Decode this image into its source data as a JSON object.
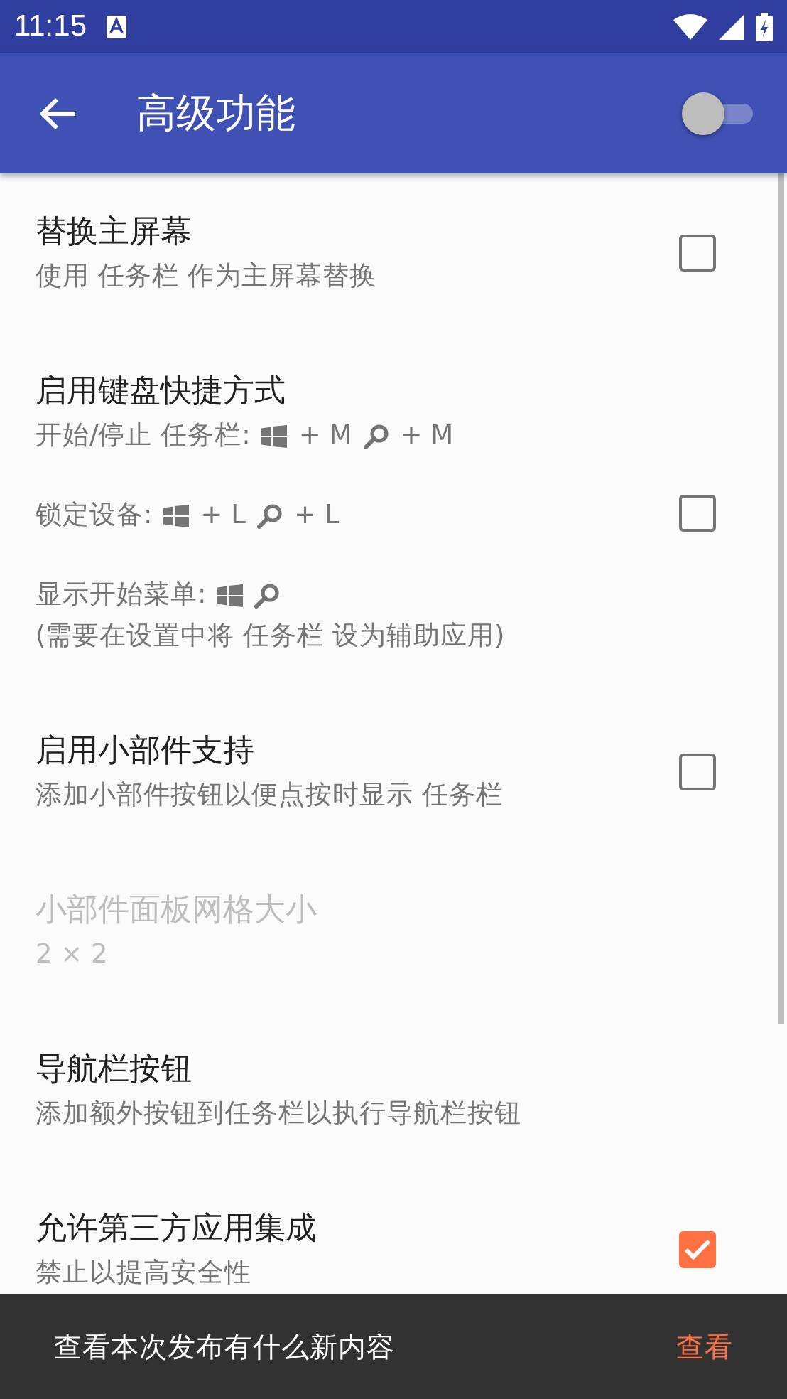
{
  "status_bar": {
    "time": "11:15"
  },
  "app_bar": {
    "title": "高级功能",
    "switch_on": false
  },
  "settings": [
    {
      "title": "替换主屏幕",
      "disabled": false,
      "checked": false,
      "groups": [
        [
          [
            {
              "kind": "text",
              "text": "使用 任务栏 作为主屏幕替换"
            }
          ]
        ]
      ]
    },
    {
      "title": "启用键盘快捷方式",
      "disabled": false,
      "checked": false,
      "groups": [
        [
          [
            {
              "kind": "text",
              "text": "开始/停止 任务栏:"
            },
            {
              "kind": "windows"
            },
            {
              "kind": "text",
              "text": "+ M"
            },
            {
              "kind": "search"
            },
            {
              "kind": "text",
              "text": "+ M"
            }
          ]
        ],
        [
          [
            {
              "kind": "text",
              "text": "锁定设备:"
            },
            {
              "kind": "windows"
            },
            {
              "kind": "text",
              "text": "+ L"
            },
            {
              "kind": "search"
            },
            {
              "kind": "text",
              "text": "+ L"
            }
          ]
        ],
        [
          [
            {
              "kind": "text",
              "text": "显示开始菜单:"
            },
            {
              "kind": "windows"
            },
            {
              "kind": "search"
            }
          ],
          [
            {
              "kind": "text",
              "text": "(需要在设置中将 任务栏 设为辅助应用)"
            }
          ]
        ]
      ]
    },
    {
      "title": "启用小部件支持",
      "disabled": false,
      "checked": false,
      "groups": [
        [
          [
            {
              "kind": "text",
              "text": "添加小部件按钮以便点按时显示 任务栏"
            }
          ]
        ]
      ]
    },
    {
      "title": "小部件面板网格大小",
      "disabled": true,
      "groups": [
        [
          [
            {
              "kind": "text",
              "text": "2 × 2"
            }
          ]
        ]
      ]
    },
    {
      "title": "导航栏按钮",
      "disabled": false,
      "groups": [
        [
          [
            {
              "kind": "text",
              "text": "添加额外按钮到任务栏以执行导航栏按钮"
            }
          ]
        ]
      ]
    },
    {
      "title": "允许第三方应用集成",
      "disabled": false,
      "checked": true,
      "groups": [
        [
          [
            {
              "kind": "text",
              "text": "禁止以提高安全性"
            }
          ]
        ]
      ]
    }
  ],
  "snackbar": {
    "message": "查看本次发布有什么新内容",
    "action": "查看"
  }
}
